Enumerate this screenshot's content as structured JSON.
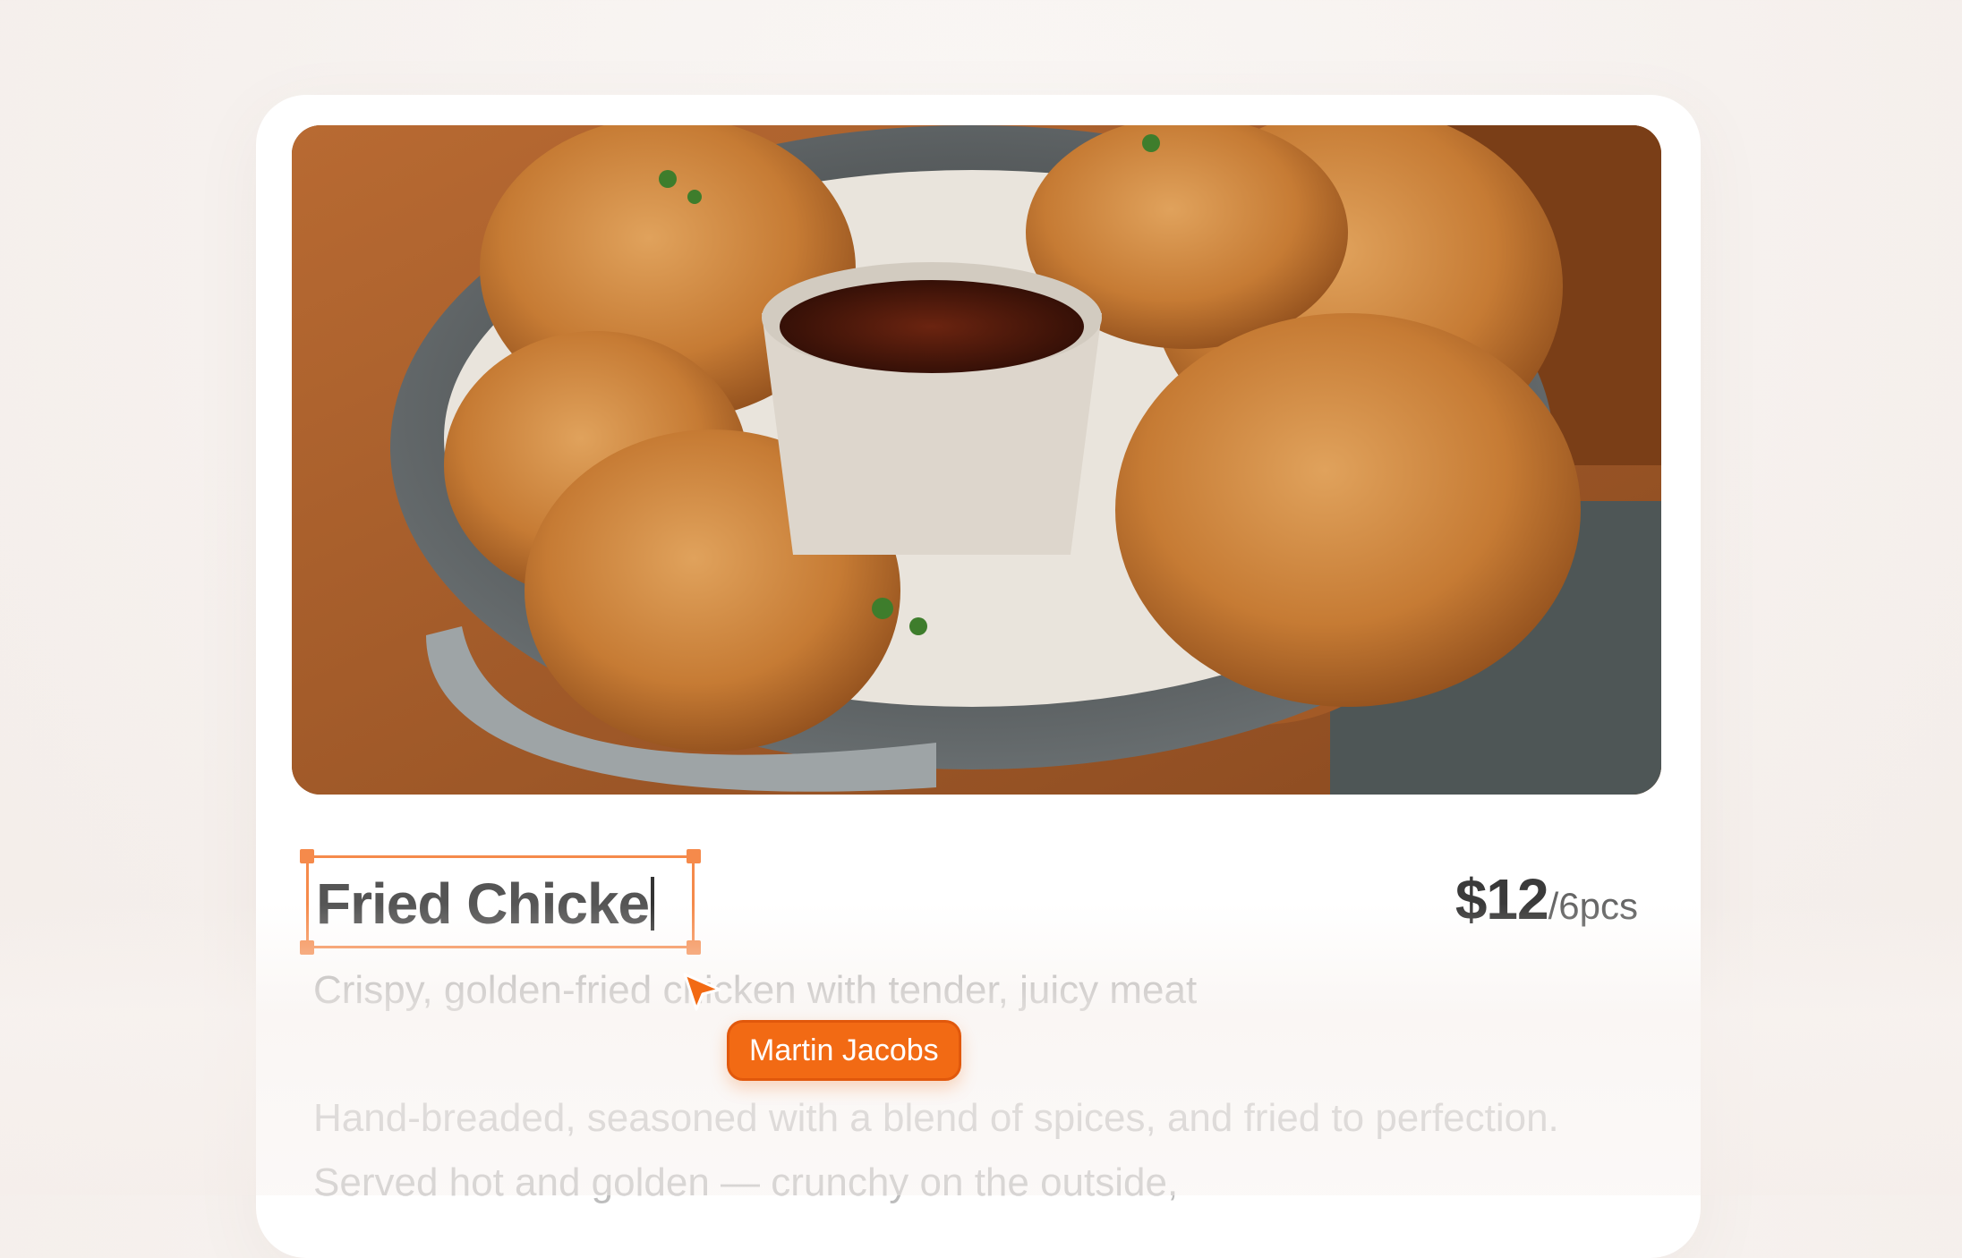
{
  "product": {
    "title": "Fried Chicke",
    "price": "$12",
    "unit": "/6pcs",
    "subtitle": "Crispy, golden-fried chicken with tender, juicy meat",
    "description": "Hand-breaded, seasoned with a blend of spices, and fried to perfection. Served hot and golden — crunchy on the outside,"
  },
  "collaborator": {
    "name": "Martin Jacobs",
    "color": "#f26a14"
  },
  "selection_color": "#f58a4b"
}
